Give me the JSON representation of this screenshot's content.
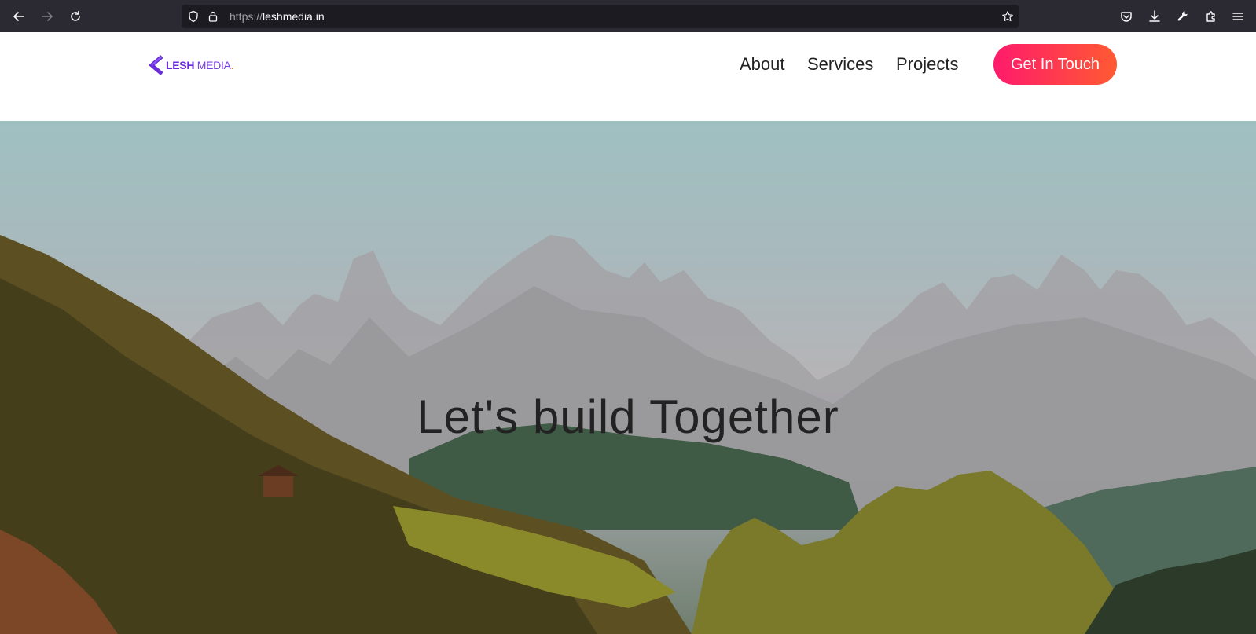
{
  "browser": {
    "url_scheme": "https://",
    "url_host": "leshmedia.in"
  },
  "header": {
    "logo": {
      "brand": "LESH",
      "suffix": "MEDIA",
      "dot": "."
    },
    "nav": [
      {
        "label": "About"
      },
      {
        "label": "Services"
      },
      {
        "label": "Projects"
      }
    ],
    "cta_label": "Get In Touch"
  },
  "hero": {
    "title": "Let's build Together",
    "image": "mountain-landscape-with-forest"
  },
  "colors": {
    "cta_start": "#ff1a6c",
    "cta_end": "#ff5a32",
    "logo_purple": "#6a2bd9"
  }
}
